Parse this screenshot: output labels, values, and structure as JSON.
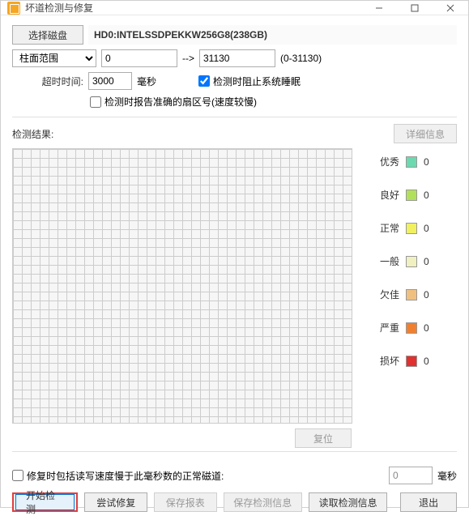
{
  "window": {
    "title": "坏道检测与修复"
  },
  "controls": {
    "selectDisk": "选择磁盘",
    "diskName": "HD0:INTELSSDPEKKW256G8(238GB)",
    "cylRangeLabel": "柱面范围",
    "cylStart": "0",
    "cylArrow": "-->",
    "cylEnd": "31130",
    "cylRangeHint": "(0-31130)",
    "timeoutLabel": "超时时间:",
    "timeoutValue": "3000",
    "timeoutUnit": "毫秒",
    "sleepBlock": "检测时阻止系统睡眠",
    "accurateSector": "检测时报告准确的扇区号(速度较慢)"
  },
  "results": {
    "label": "检测结果:",
    "detailBtn": "详细信息",
    "resetBtn": "复位"
  },
  "legend": [
    {
      "label": "优秀",
      "color": "#6dd9b0",
      "count": "0"
    },
    {
      "label": "良好",
      "color": "#b3e05a",
      "count": "0"
    },
    {
      "label": "正常",
      "color": "#f0f060",
      "count": "0"
    },
    {
      "label": "一般",
      "color": "#f0f0c0",
      "count": "0"
    },
    {
      "label": "欠佳",
      "color": "#f0c080",
      "count": "0"
    },
    {
      "label": "严重",
      "color": "#f08030",
      "count": "0"
    },
    {
      "label": "损坏",
      "color": "#e03030",
      "count": "0"
    }
  ],
  "bottom": {
    "repairSlowLabel": "修复时包括读写速度慢于此毫秒数的正常磁道:",
    "repairSlowValue": "0",
    "repairSlowUnit": "毫秒",
    "startBtn": "开始检测",
    "repairBtn": "尝试修复",
    "saveReport": "保存报表",
    "saveInfo": "保存检测信息",
    "loadInfo": "读取检测信息",
    "exitBtn": "退出"
  }
}
